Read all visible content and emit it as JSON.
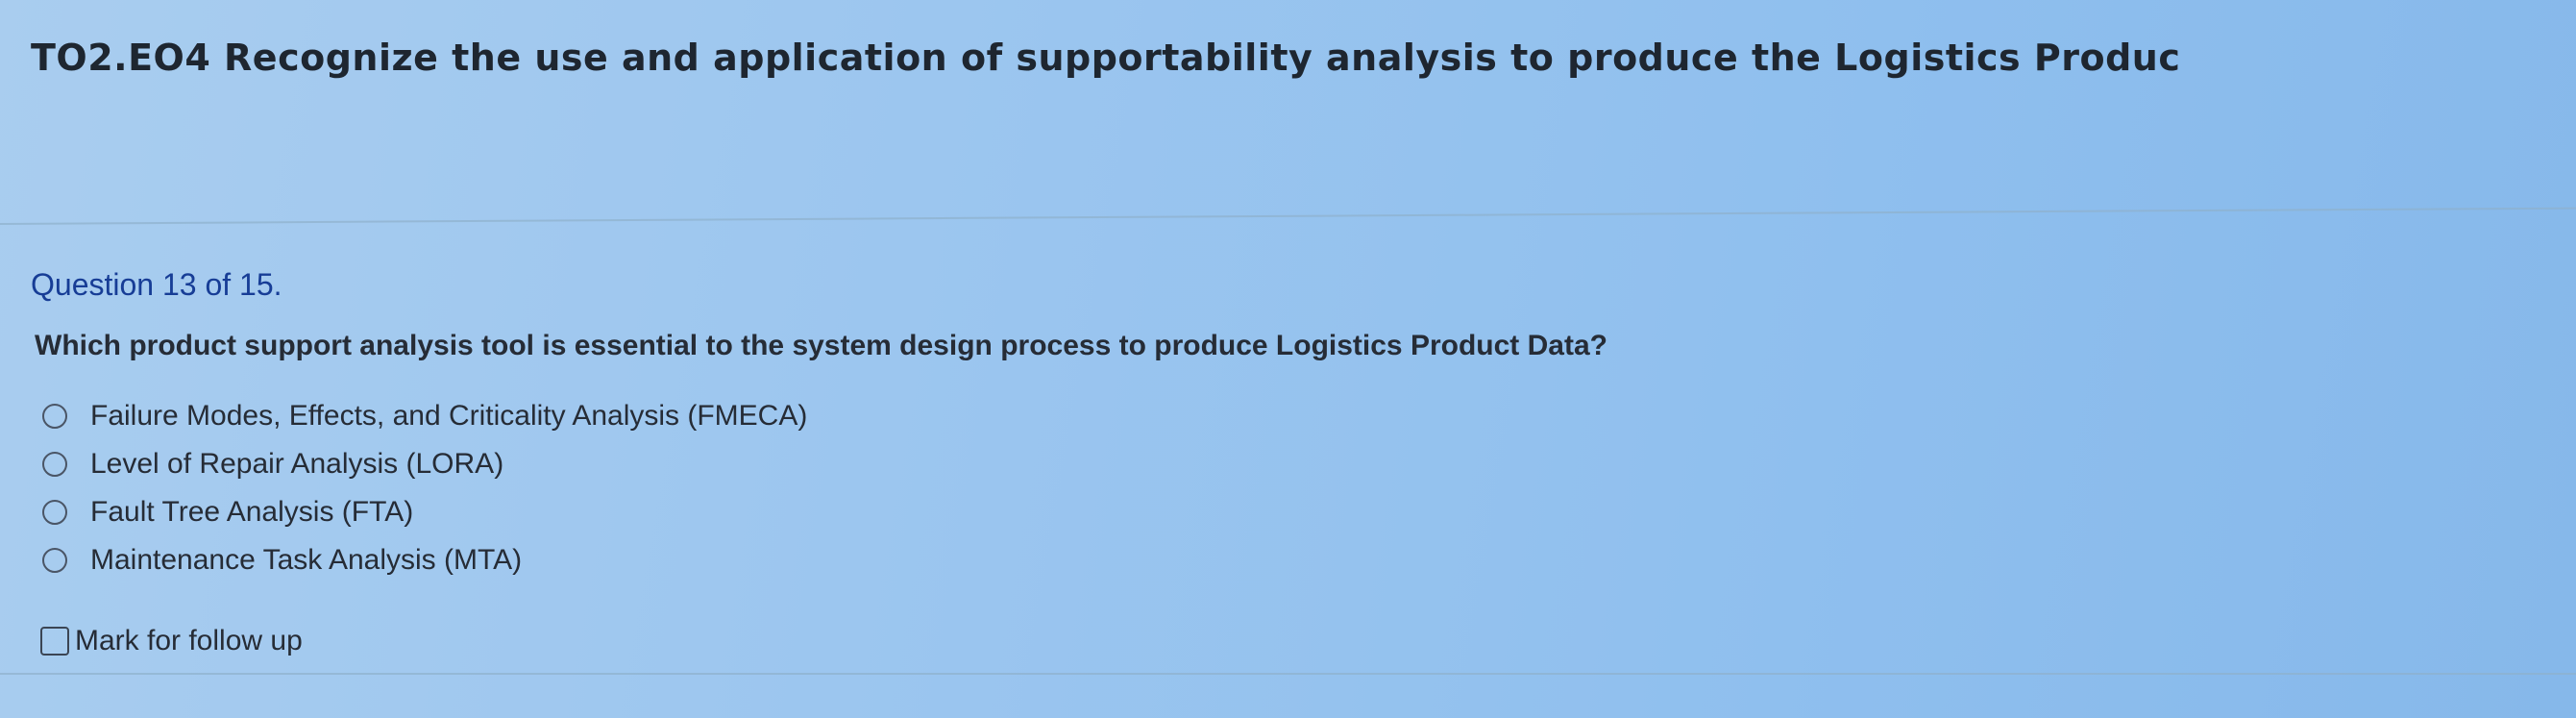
{
  "header": {
    "title": "TO2.EO4 Recognize the use and application of supportability analysis to produce the Logistics Produc"
  },
  "question": {
    "number_label": "Question 13 of 15.",
    "text": "Which product support analysis tool is essential to the system design process to produce Logistics Product Data?",
    "options": [
      {
        "label": "Failure Modes, Effects, and Criticality Analysis (FMECA)",
        "selected": false
      },
      {
        "label": "Level of Repair Analysis (LORA)",
        "selected": false
      },
      {
        "label": "Fault Tree Analysis (FTA)",
        "selected": false
      },
      {
        "label": "Maintenance Task Analysis (MTA)",
        "selected": false
      }
    ]
  },
  "followup": {
    "label": "Mark for follow up",
    "checked": false
  },
  "colors": {
    "accent": "#173d96",
    "text": "#262c36"
  }
}
